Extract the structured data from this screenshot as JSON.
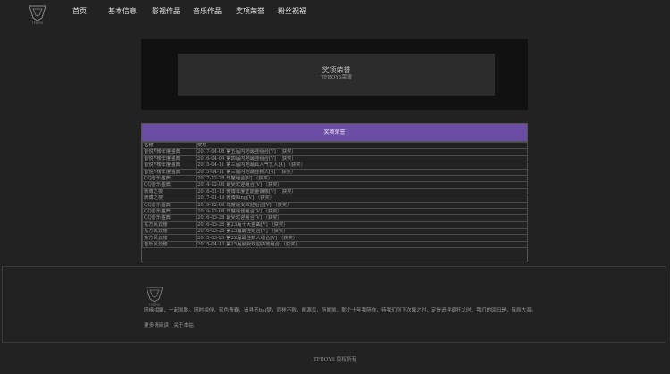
{
  "header": {
    "logo_text": "TFBOYS",
    "nav": [
      "首页",
      "基本信息",
      "影视作品",
      "音乐作品",
      "奖项荣誉",
      "粉丝祝福"
    ]
  },
  "hero": {
    "title": "奖项荣誉",
    "subtitle": "TFBOYS荣耀"
  },
  "awards": {
    "heading": "奖项荣誉",
    "columns": [
      "名称",
      "奖项"
    ],
    "rows": [
      [
        "音悦V榜年度盛典",
        "2017-04-08 第五届内地最佳组合[V] （获奖）"
      ],
      [
        "音悦V榜年度盛典",
        "2016-04-09 第四届内地最佳组合[V] （获奖）"
      ],
      [
        "音悦V榜年度盛典",
        "2015-04-11 第三届内地最具人气艺人[4] （获奖）"
      ],
      [
        "音悦V榜年度盛典",
        "2015-04-11 第三届内地最佳新人[4] （获奖）"
      ],
      [
        "QQ音乐盛典",
        "2017-12-28 年度组合[V] （获奖）"
      ],
      [
        "QQ音乐盛典",
        "2014-12-06 最受欢迎组合[V] （获奖）"
      ],
      [
        "微博之夜",
        "2018-01-18 微博年度正能量偶像[V] （获奖）"
      ],
      [
        "微博之夜",
        "2017-01-16 微博King[V] （获奖）"
      ],
      [
        "QQ音乐盛典",
        "2019-12-08 年度最受欢迎组合[V] （获奖）"
      ],
      [
        "QQ音乐盛典",
        "2019-12-08 年度最佳组合[V] （获奖）"
      ],
      [
        "QQ音乐盛典",
        "2016-03-28 最受欢迎组合[V] （获奖）"
      ],
      [
        "东方风云榜",
        "2016-03-26 第23届十大金曲[V] （获奖）"
      ],
      [
        "东方风云榜",
        "2016-03-26 第23届最佳组合[V] （获奖）"
      ],
      [
        "东方风云榜",
        "2015-03-29 第22届最佳新人组合[V] （获奖）"
      ],
      [
        "音乐风云榜",
        "2015-04-13 第15届最受欢迎内地组合 （获奖）"
      ]
    ]
  },
  "footer": {
    "logo_text": "TFBOYS",
    "blurb": "因缘相聚，一起凯聪。因时相伴，蓝色青春，追寻不bai梦，同样不败，凯源玺，所凯凯，那个十年我陪你，待我们到下次聚之时，定是追寻疯狂之时，我们的回归是，星辰大海。",
    "links": [
      "更多请阅读",
      "关于本站"
    ],
    "copyright": "TFBOYS 版权所有"
  },
  "colors": {
    "background": "#222222",
    "hero_bg": "#111111",
    "accent_purple": "#6b4ea4"
  }
}
